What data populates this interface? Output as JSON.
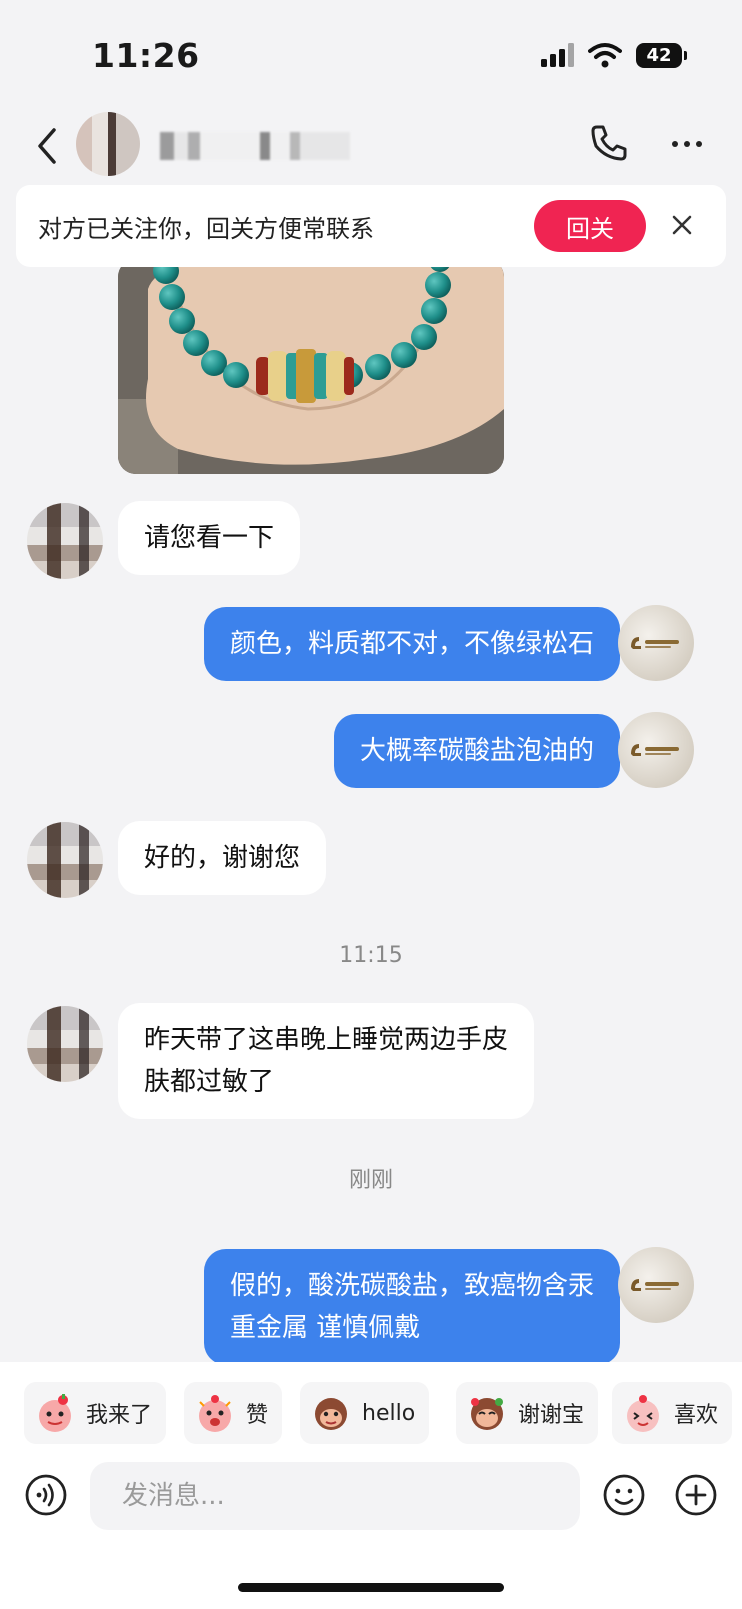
{
  "status_bar": {
    "time": "11:26",
    "battery": "42"
  },
  "header": {
    "contact_name": ""
  },
  "follow_banner": {
    "text": "对方已关注你，回关方便常联系",
    "button": "回关"
  },
  "messages": [
    {
      "from": "them",
      "text": "请您看一下"
    },
    {
      "from": "me",
      "text": "颜色，料质都不对，不像绿松石"
    },
    {
      "from": "me",
      "text": "大概率碳酸盐泡油的"
    },
    {
      "from": "them",
      "text": "好的，谢谢您"
    },
    {
      "from": "them",
      "lines": [
        "昨天带了这串晚上睡觉两边手皮",
        "肤都过敏了"
      ]
    },
    {
      "from": "me",
      "lines": [
        "假的，酸洗碳酸盐，致癌物含汞",
        "重金属 谨慎佩戴"
      ]
    }
  ],
  "timestamps": [
    "11:15",
    "刚刚"
  ],
  "quick_replies": [
    "我来了",
    "赞",
    "hello",
    "谢谢宝",
    "喜欢"
  ],
  "input": {
    "placeholder": "发消息..."
  },
  "colors": {
    "accent_red": "#f02452",
    "bubble_blue": "#3d82ec",
    "background": "#f3f3f5"
  }
}
